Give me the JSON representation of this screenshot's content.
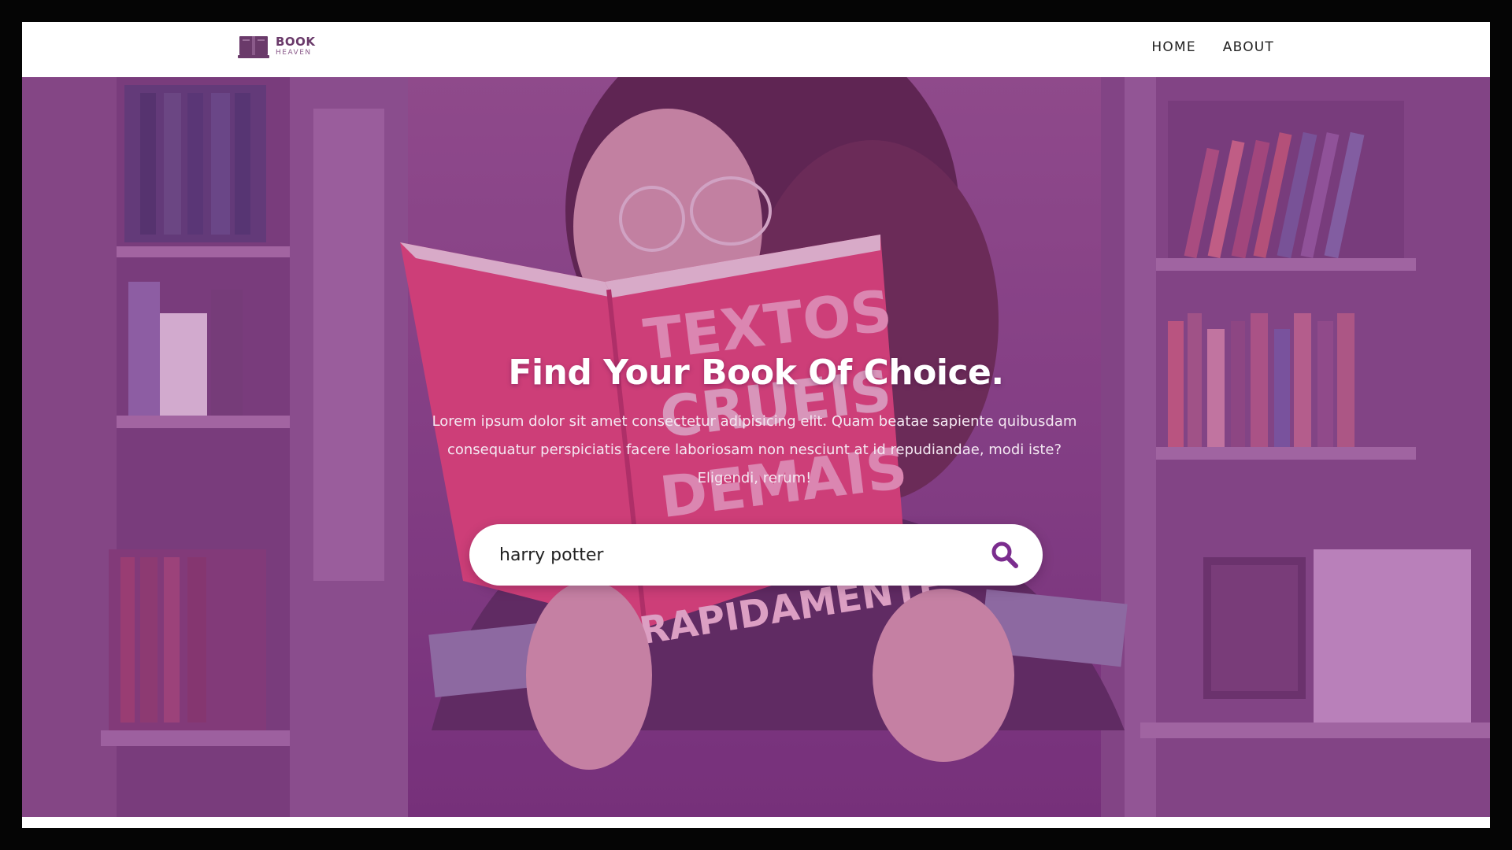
{
  "brand": {
    "title": "BOOK",
    "subtitle": "HEAVEN",
    "icon": "book-icon"
  },
  "nav": {
    "items": [
      {
        "label": "HOME"
      },
      {
        "label": "ABOUT"
      }
    ]
  },
  "hero": {
    "title": "Find Your Book Of Choice.",
    "description": "Lorem ipsum dolor sit amet consectetur adipisicing elit. Quam beatae sapiente quibusdam consequatur perspiciatis facere laboriosam non nesciunt at id repudiandae, modi iste? Eligendi, rerum!",
    "background": "woman-reading-book-photo",
    "overlay_color": "#8b3d8b"
  },
  "search": {
    "value": "harry potter",
    "icon": "search-icon",
    "icon_color": "#7b2d8e"
  }
}
